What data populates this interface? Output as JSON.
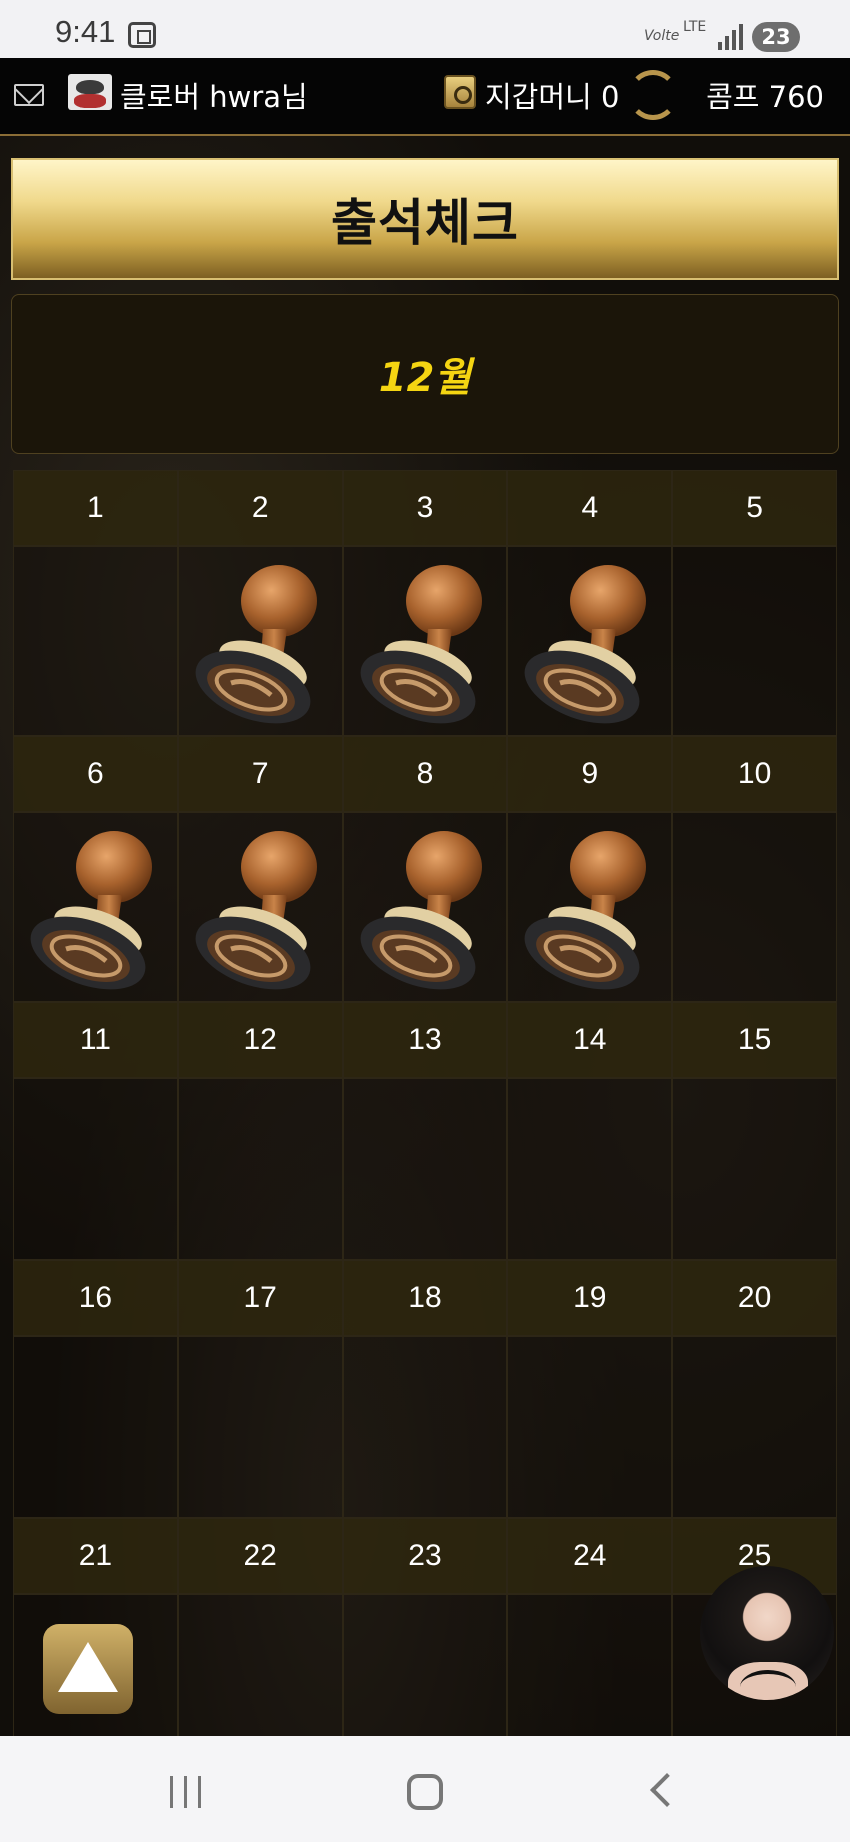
{
  "status_bar": {
    "time": "9:41",
    "volte": "Volte",
    "lte": "LTE",
    "battery": "23"
  },
  "topnav": {
    "username": "클로버 hwra님",
    "wallet": "지갑머니 0",
    "comp": "콤프 760"
  },
  "title": "출석체크",
  "month": "12월",
  "colors": {
    "gold_light": "#fff5c8",
    "gold_dark": "#7d5f22",
    "month_yellow": "#f5d512",
    "background": "#110e0a"
  },
  "calendar": {
    "weeks": [
      {
        "days": [
          "1",
          "2",
          "3",
          "4",
          "5"
        ],
        "stamped": [
          false,
          true,
          true,
          true,
          false
        ]
      },
      {
        "days": [
          "6",
          "7",
          "8",
          "9",
          "10"
        ],
        "stamped": [
          true,
          true,
          true,
          true,
          false
        ]
      },
      {
        "days": [
          "11",
          "12",
          "13",
          "14",
          "15"
        ],
        "stamped": [
          false,
          false,
          false,
          false,
          false
        ]
      },
      {
        "days": [
          "16",
          "17",
          "18",
          "19",
          "20"
        ],
        "stamped": [
          false,
          false,
          false,
          false,
          false
        ]
      },
      {
        "days": [
          "21",
          "22",
          "23",
          "24",
          "25"
        ],
        "stamped": [
          false,
          false,
          false,
          false,
          false
        ]
      }
    ]
  }
}
